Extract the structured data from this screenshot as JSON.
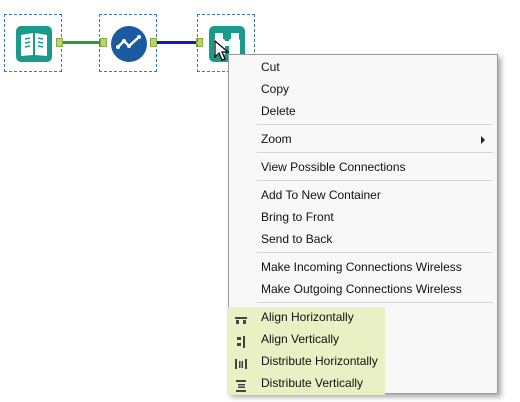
{
  "menu": {
    "items": [
      {
        "label": "Cut"
      },
      {
        "label": "Copy"
      },
      {
        "label": "Delete"
      },
      {
        "label": "Zoom"
      },
      {
        "label": "View Possible Connections"
      },
      {
        "label": "Add To New Container"
      },
      {
        "label": "Bring to Front"
      },
      {
        "label": "Send to Back"
      },
      {
        "label": "Make Incoming Connections Wireless"
      },
      {
        "label": "Make Outgoing Connections Wireless"
      },
      {
        "label": "Align Horizontally"
      },
      {
        "label": "Align Vertically"
      },
      {
        "label": "Distribute Horizontally"
      },
      {
        "label": "Distribute Vertically"
      }
    ]
  },
  "colors": {
    "tool_teal": "#1a9a8a",
    "tool_blue": "#1b5aa0",
    "connection_green": "#2e9a3a",
    "connection_blue": "#1a1aa8",
    "highlight": "#e9f0c4"
  },
  "icons": [
    "book-input-icon",
    "check-flow-icon",
    "binoculars-icon",
    "align-horizontal-icon",
    "align-vertical-icon",
    "distribute-horizontal-icon",
    "distribute-vertical-icon",
    "cursor-icon"
  ]
}
